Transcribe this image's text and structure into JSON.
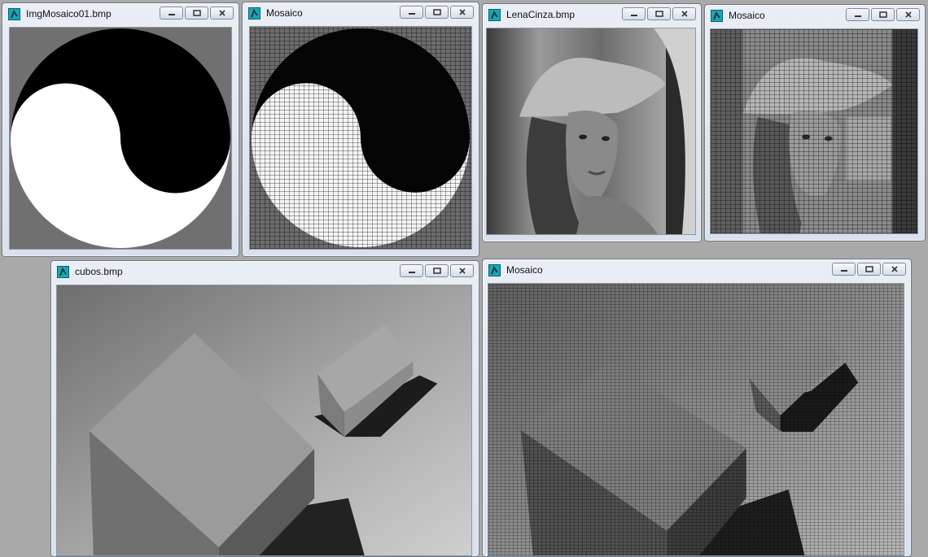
{
  "windows": [
    {
      "title": "ImgMosaico01.bmp"
    },
    {
      "title": "Mosaico"
    },
    {
      "title": "LenaCinza.bmp"
    },
    {
      "title": "Mosaico"
    },
    {
      "title": "cubos.bmp"
    },
    {
      "title": "Mosaico"
    }
  ],
  "icons": {
    "app": "app-icon",
    "minimize": "minimize-icon",
    "maximize": "maximize-icon",
    "close": "close-icon"
  }
}
